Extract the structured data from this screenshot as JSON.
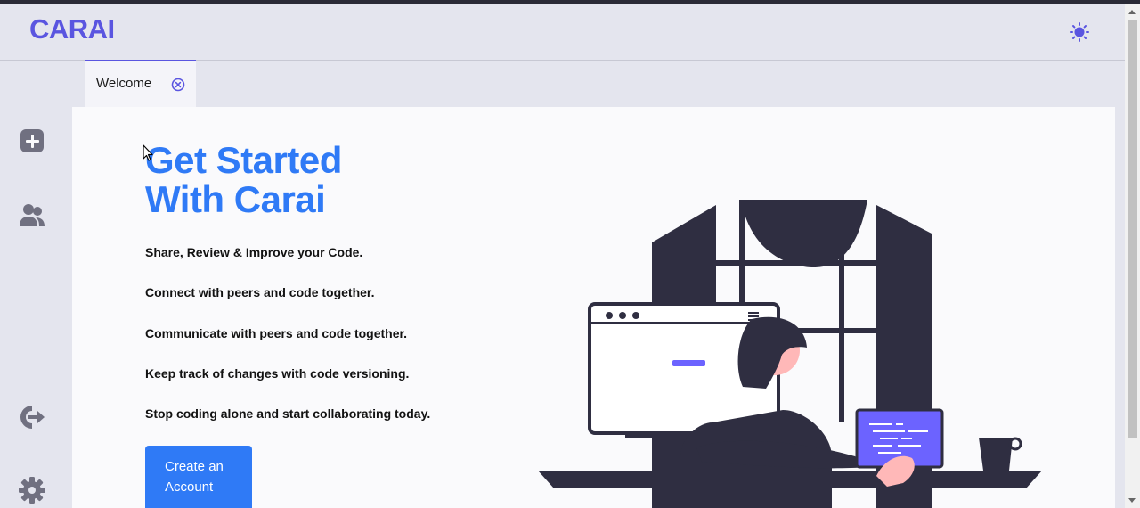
{
  "app": {
    "logo": "CARAI"
  },
  "header": {
    "theme_toggle_icon": "sun-icon"
  },
  "sidebar": {
    "items": [
      {
        "icon": "plus-icon"
      },
      {
        "icon": "users-icon"
      },
      {
        "icon": "sign-out-icon"
      },
      {
        "icon": "gear-icon"
      }
    ]
  },
  "tabs": [
    {
      "label": "Welcome",
      "close_icon": "close-circle-icon"
    }
  ],
  "welcome": {
    "title_line1": "Get Started",
    "title_line2": "With Carai",
    "features": [
      "Share, Review & Improve your Code.",
      "Connect with peers and code together.",
      "Communicate with peers and code together.",
      "Keep track of changes with code versioning.",
      "Stop coding alone and start collaborating today."
    ],
    "cta_label": "Create an Account"
  },
  "colors": {
    "brand": "#5a55e0",
    "primary": "#2f7af6",
    "background": "#e4e5ee",
    "panel": "#fafafc",
    "illustration_dark": "#2f2e41"
  }
}
